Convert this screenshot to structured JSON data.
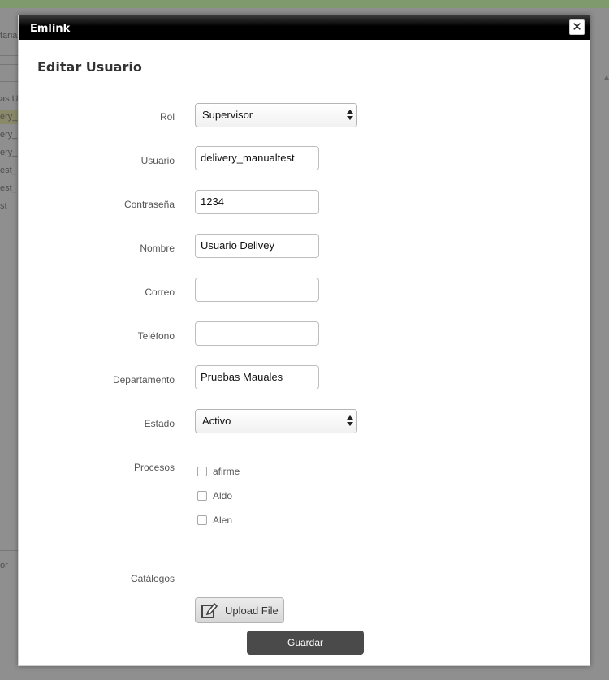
{
  "background": {
    "top_label": "taria",
    "list_header": "as Us",
    "list_items": [
      "ery_m",
      "ery_u",
      "ery_u",
      "est_",
      "est_",
      "st"
    ],
    "bottom_label": "or"
  },
  "modal": {
    "title": "Emlink",
    "close_label": "✕",
    "heading": "Editar Usuario"
  },
  "form": {
    "rol": {
      "label": "Rol",
      "value": "Supervisor"
    },
    "usuario": {
      "label": "Usuario",
      "value": "delivery_manualtest"
    },
    "contrasena": {
      "label": "Contraseña",
      "value": "1234"
    },
    "nombre": {
      "label": "Nombre",
      "value": "Usuario Delivey"
    },
    "correo": {
      "label": "Correo",
      "value": ""
    },
    "telefono": {
      "label": "Teléfono",
      "value": ""
    },
    "departamento": {
      "label": "Departamento",
      "value": "Pruebas Mauales"
    },
    "estado": {
      "label": "Estado",
      "value": "Activo"
    },
    "procesos": {
      "label": "Procesos",
      "options": [
        {
          "label": "afirme",
          "checked": false
        },
        {
          "label": "Aldo",
          "checked": false
        },
        {
          "label": "Alen",
          "checked": false
        }
      ]
    },
    "catalogos": {
      "label": "Catálogos"
    },
    "upload_label": "Upload File",
    "save_label": "Guardar"
  },
  "icons": {
    "upload": "edit-document-icon",
    "close": "close-icon"
  },
  "colors": {
    "titlebar": "#000000",
    "save_button": "#4a4a4a",
    "overlay": "#8f8f8f"
  }
}
